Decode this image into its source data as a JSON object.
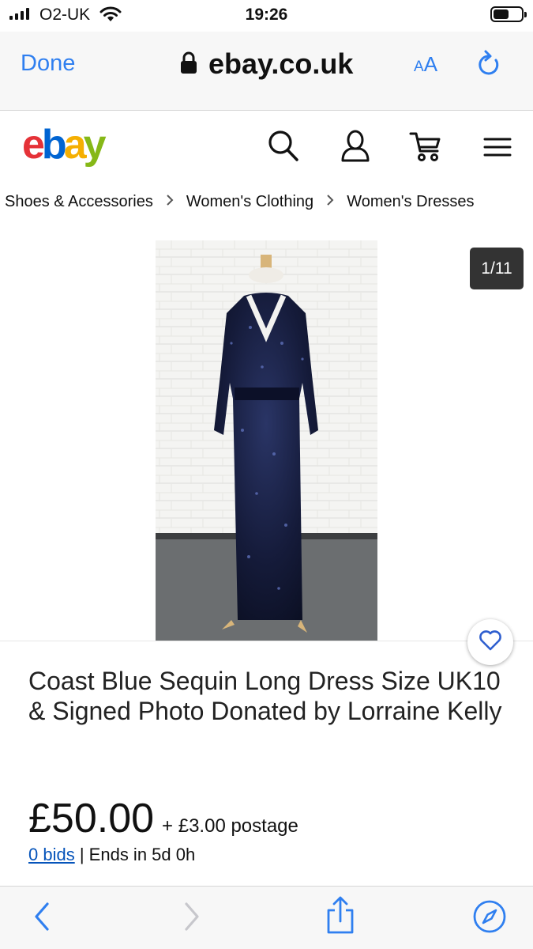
{
  "status_bar": {
    "carrier": "O2-UK",
    "time": "19:26",
    "battery_level": 0.55
  },
  "browser": {
    "done_label": "Done",
    "url": "ebay.co.uk",
    "text_size_label_small": "A",
    "text_size_label_large": "A",
    "accent_color": "#2f7ff0"
  },
  "header": {
    "logo": {
      "e": "e",
      "b": "b",
      "a": "a",
      "y": "y"
    },
    "icons": [
      "search-icon",
      "account-icon",
      "cart-icon",
      "menu-icon"
    ]
  },
  "breadcrumb": {
    "items": [
      "Shoes & Accessories",
      "Women's Clothing",
      "Women's Dresses"
    ],
    "separator": ">"
  },
  "gallery": {
    "counter": "1/11"
  },
  "listing": {
    "title": "Coast Blue Sequin Long Dress Size UK10 & Signed Photo Donated by Lorraine Kelly",
    "price": "£50.00",
    "postage": "+ £3.00 postage",
    "bids_link": "0 bids",
    "ends": "| Ends in 5d 0h"
  },
  "toolbar": {
    "icons": [
      "back-icon",
      "forward-icon",
      "share-icon",
      "compass-icon"
    ]
  }
}
